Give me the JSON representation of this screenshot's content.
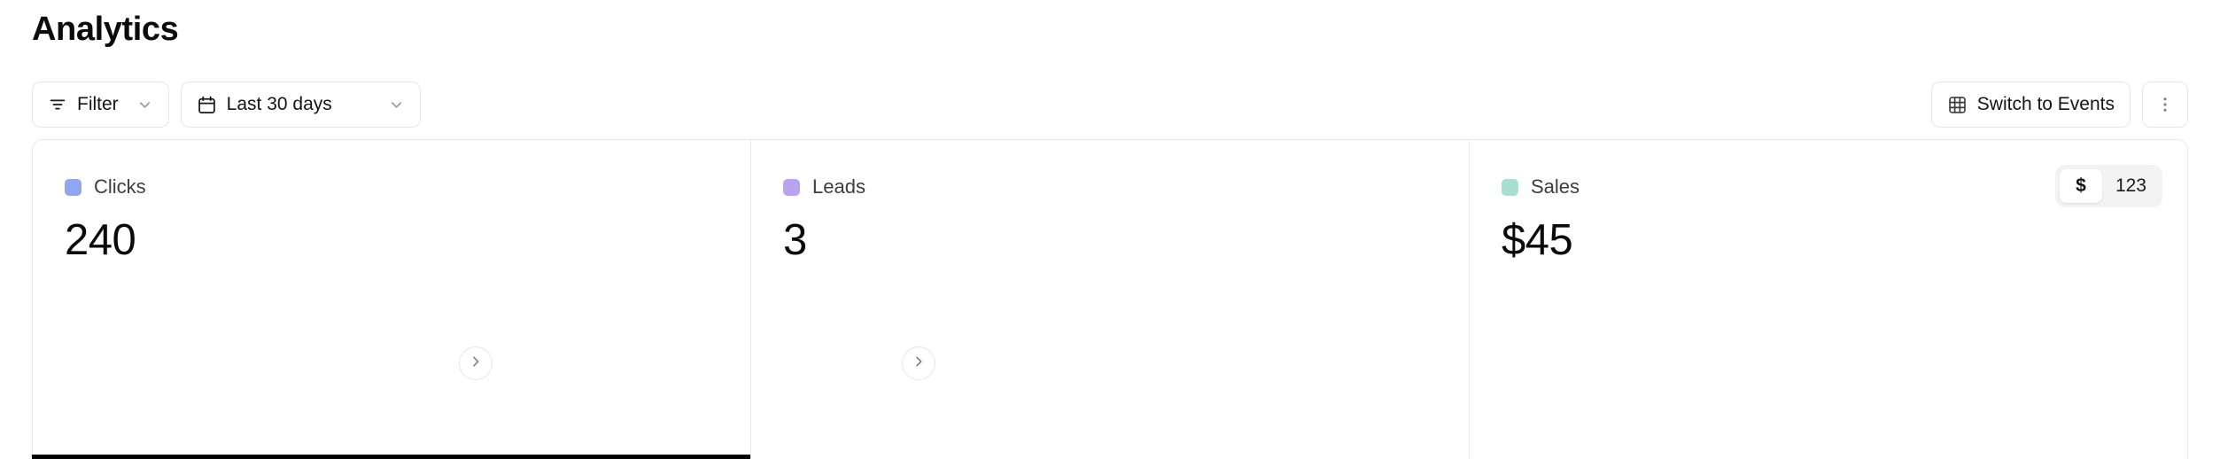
{
  "header": {
    "title": "Analytics"
  },
  "toolbar": {
    "filter": {
      "label": "Filter",
      "icon": "filter-icon",
      "chevron": "chevron-down-icon"
    },
    "date_range": {
      "label": "Last 30 days",
      "icon": "calendar-icon",
      "chevron": "chevron-down-icon"
    },
    "switch_view": {
      "label": "Switch to Events",
      "icon": "grid-icon"
    },
    "more_menu": {
      "label": "",
      "icon": "more-vertical-icon"
    }
  },
  "metrics": {
    "cards": [
      {
        "label": "Clicks",
        "value": "240",
        "color": "#8FA7F0",
        "active": true
      },
      {
        "label": "Leads",
        "value": "3",
        "color": "#B9A3EE",
        "active": false
      },
      {
        "label": "Sales",
        "value": "$45",
        "color": "#A7E0D0",
        "active": false
      }
    ],
    "dividers": [
      {
        "icon": "chevron-right-icon"
      },
      {
        "icon": "chevron-right-icon"
      }
    ],
    "sales_toggle": {
      "options": [
        {
          "label": "$",
          "selected": true
        },
        {
          "label": "123",
          "selected": false
        }
      ]
    }
  },
  "colors": {
    "active_indicator": "#000000",
    "border": "#e8e8ea",
    "text_primary": "#0a0a0b",
    "text_secondary": "#3c3c42"
  }
}
